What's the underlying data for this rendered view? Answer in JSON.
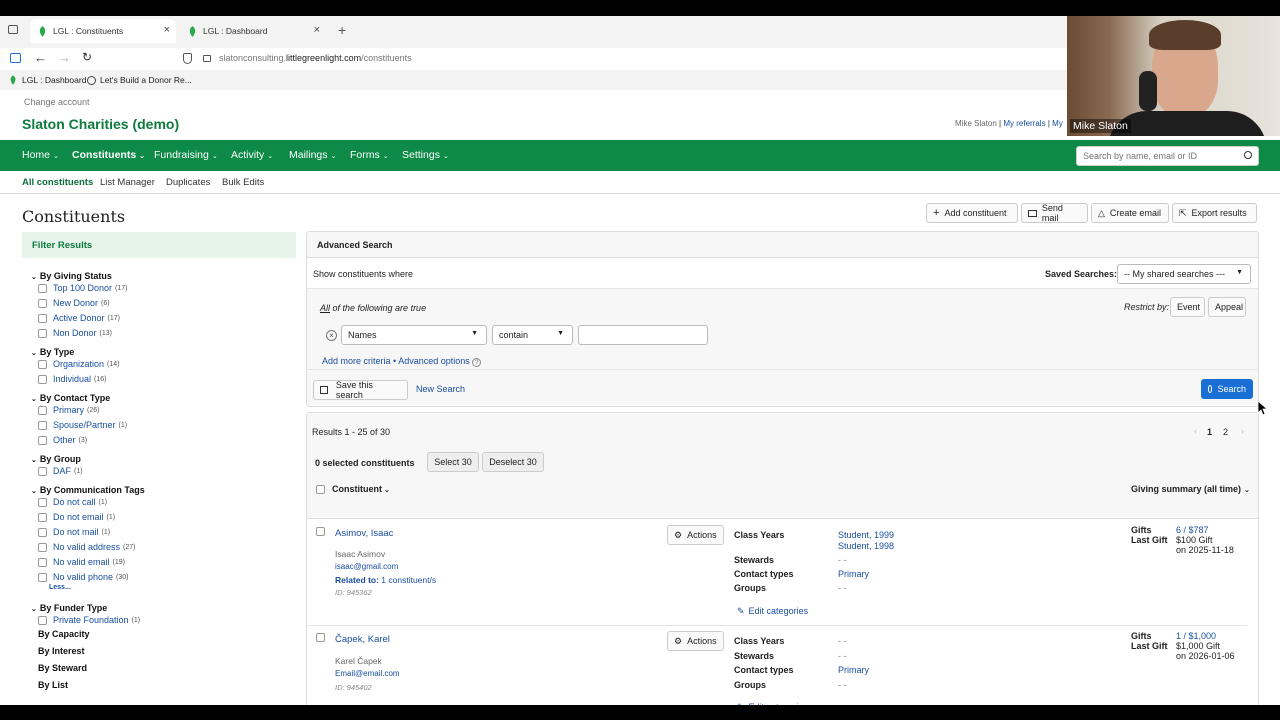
{
  "browser": {
    "tabs": [
      {
        "title": "LGL : Constituents",
        "active": true
      },
      {
        "title": "LGL : Dashboard",
        "active": false
      }
    ],
    "url_prefix": "slatonconsulting.",
    "url_domain": "littlegreenlight.com",
    "url_path": "/constituents",
    "bookmarks": [
      "LGL : Dashboard",
      "Let's Build a Donor Re..."
    ]
  },
  "header": {
    "change_account": "Change account",
    "org_name": "Slaton Charities (demo)",
    "user_name": "Mike Slaton",
    "sep": "|",
    "my_referrals": "My referrals",
    "my_trunc": "My",
    "video_name": "Mike Slaton"
  },
  "nav": {
    "items": [
      "Home",
      "Constituents",
      "Fundraising",
      "Activity",
      "Mailings",
      "Forms",
      "Settings"
    ],
    "search_placeholder": "Search by name, email or ID"
  },
  "subnav": {
    "items": [
      "All constituents",
      "List Manager",
      "Duplicates",
      "Bulk Edits"
    ]
  },
  "page_title": "Constituents",
  "actions": [
    "Add constituent",
    "Send mail",
    "Create email",
    "Export results"
  ],
  "filters": {
    "title": "Filter Results",
    "groups": [
      {
        "title": "By Giving Status",
        "items": [
          {
            "label": "Top 100 Donor",
            "count": "(17)"
          },
          {
            "label": "New Donor",
            "count": "(6)"
          },
          {
            "label": "Active Donor",
            "count": "(17)"
          },
          {
            "label": "Non Donor",
            "count": "(13)"
          }
        ]
      },
      {
        "title": "By Type",
        "items": [
          {
            "label": "Organization",
            "count": "(14)"
          },
          {
            "label": "Individual",
            "count": "(16)"
          }
        ]
      },
      {
        "title": "By Contact Type",
        "items": [
          {
            "label": "Primary",
            "count": "(26)"
          },
          {
            "label": "Spouse/Partner",
            "count": "(1)"
          },
          {
            "label": "Other",
            "count": "(3)"
          }
        ]
      },
      {
        "title": "By Group",
        "items": [
          {
            "label": "DAF",
            "count": "(1)"
          }
        ]
      },
      {
        "title": "By Communication Tags",
        "items": [
          {
            "label": "Do not call",
            "count": "(1)"
          },
          {
            "label": "Do not email",
            "count": "(1)"
          },
          {
            "label": "Do not mail",
            "count": "(1)"
          },
          {
            "label": "No valid address",
            "count": "(27)"
          },
          {
            "label": "No valid email",
            "count": "(19)"
          },
          {
            "label": "No valid phone",
            "count": "(30)"
          }
        ]
      },
      {
        "title": "By Funder Type",
        "items": [
          {
            "label": "Private Foundation",
            "count": "(1)"
          }
        ]
      }
    ],
    "less": "Less...",
    "collapsed": [
      "By Capacity",
      "By Interest",
      "By Steward",
      "By List"
    ]
  },
  "advanced": {
    "title": "Advanced Search",
    "show_where": "Show constituents where",
    "saved_label": "Saved Searches:",
    "saved_value": "-- My shared searches ---",
    "all_word": "All",
    "all_rest": " of the following are true",
    "restrict_label": "Restrict by:",
    "restrict_event": "Event",
    "restrict_appeal": "Appeal",
    "field_value": "Names",
    "op_value": "contain",
    "add_more": "Add more criteria",
    "bullet": "•",
    "adv_options": "Advanced options",
    "save_search": "Save this search",
    "new_search": "New Search",
    "search_btn": "Search"
  },
  "results": {
    "summary": "Results 1 - 25 of 30",
    "pages": [
      "1",
      "2"
    ],
    "selected": "0 selected constituents",
    "select_all": "Select 30",
    "deselect_all": "Deselect 30",
    "col_constituent": "Constituent",
    "col_giving": "Giving summary (all time)",
    "actions_label": "Actions",
    "edit_categories": "Edit categories",
    "lbl_class_years": "Class Years",
    "lbl_stewards": "Stewards",
    "lbl_contact_types": "Contact types",
    "lbl_groups": "Groups",
    "lbl_gifts": "Gifts",
    "lbl_last_gift": "Last Gift",
    "empty": "- -",
    "rows": [
      {
        "name": "Asimov, Isaac",
        "display": "Isaac Asimov",
        "email": "isaac@gmail.com",
        "related_label": "Related to:",
        "related": "1 constituent/s",
        "id": "ID: 945362",
        "class_years": [
          "Student, 1999",
          "Student, 1998"
        ],
        "contact_type": "Primary",
        "gifts": "6 / $787",
        "last_gift": "$100 Gift",
        "last_gift_date": "on 2025-11-18"
      },
      {
        "name": "Čapek, Karel",
        "display": "Karel Čapek",
        "email": "Email@email.com",
        "id": "ID: 945402",
        "contact_type": "Primary",
        "gifts": "1 / $1,000",
        "last_gift": "$1,000 Gift",
        "last_gift_date": "on 2026-01-06"
      }
    ]
  },
  "colors": {
    "brand_green": "#0e8a47",
    "link_blue": "#1a4fa0",
    "search_blue": "#1a6fd6"
  }
}
